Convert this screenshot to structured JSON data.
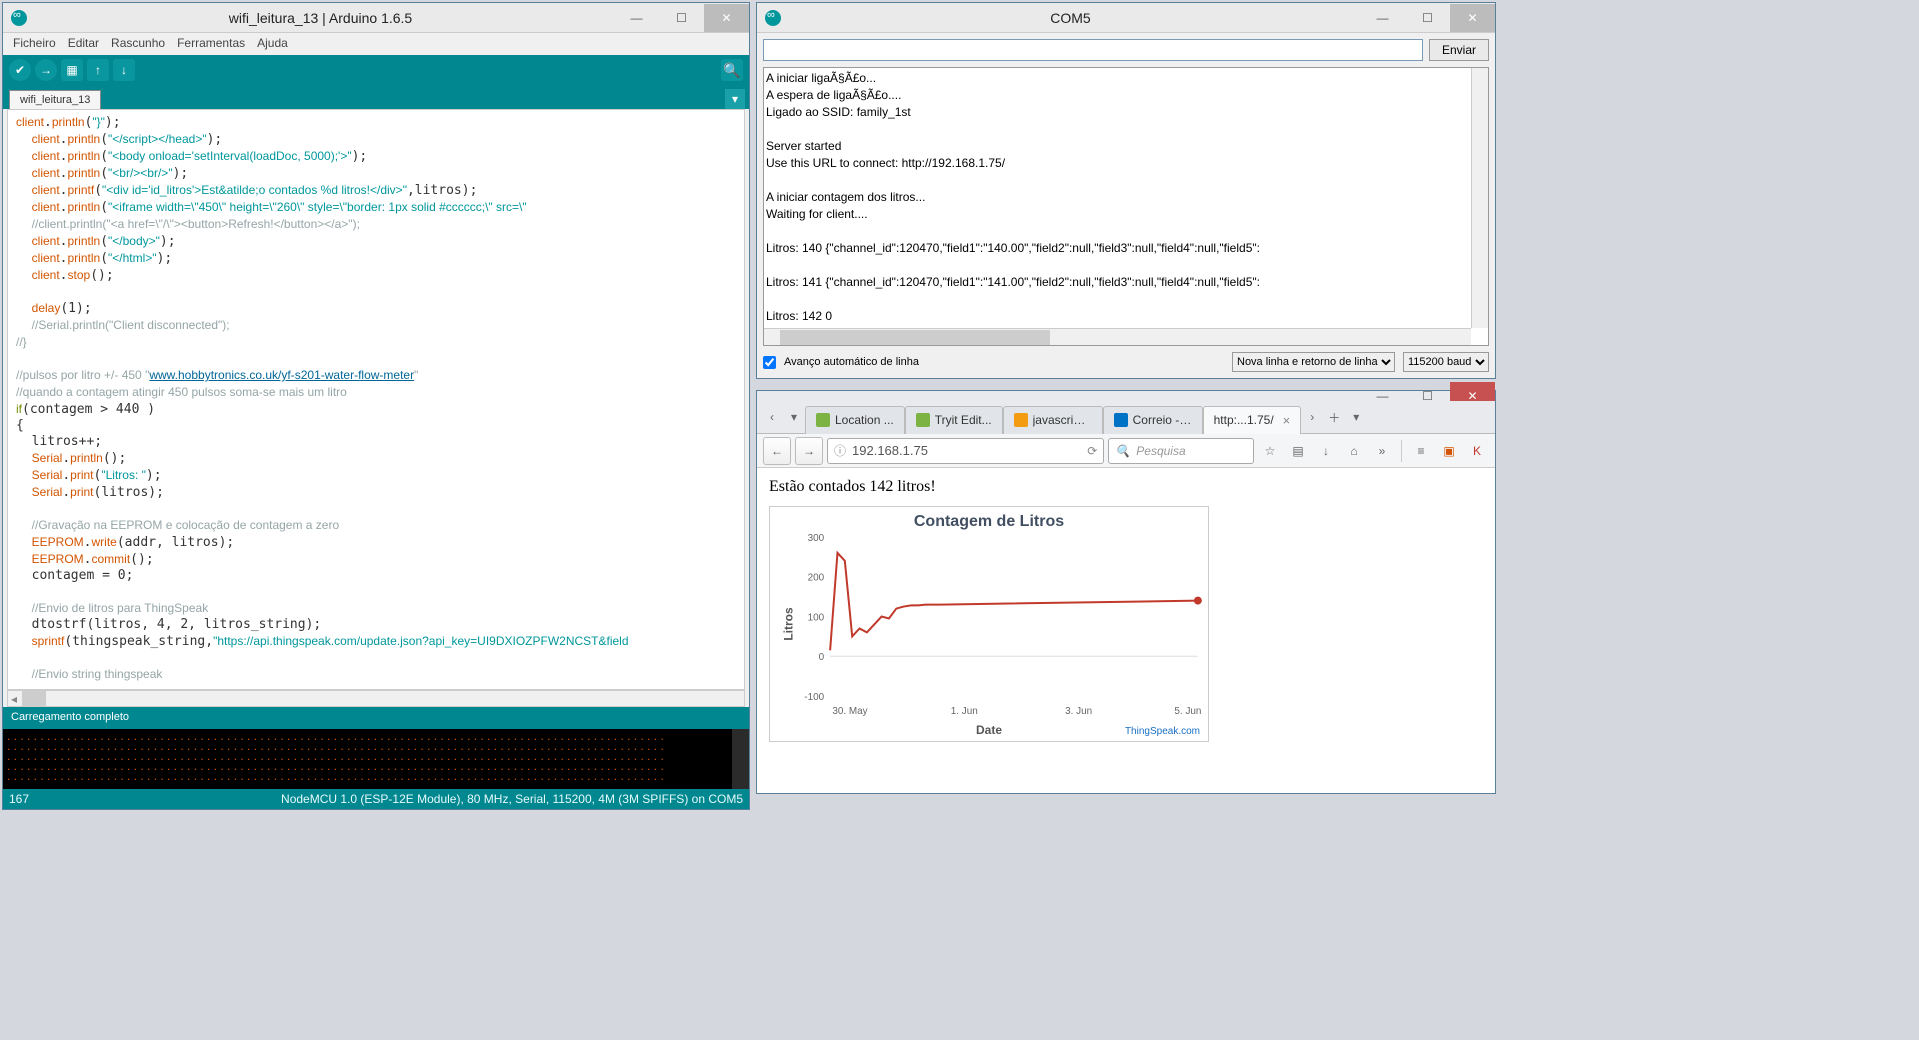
{
  "arduino": {
    "title": "wifi_leitura_13 | Arduino 1.6.5",
    "menus": [
      "Ficheiro",
      "Editar",
      "Rascunho",
      "Ferramentas",
      "Ajuda"
    ],
    "tab_name": "wifi_leitura_13",
    "status": "Carregamento completo",
    "footer_left": "167",
    "footer_right": "NodeMCU 1.0 (ESP-12E Module), 80 MHz, Serial, 115200, 4M (3M SPIFFS) on COM5",
    "console_dots": ". . . . . . . . . . . . . . . . . . . . . . . . . . . . . . . . . . . . . . . . . . . . . . . . . . . . . . . . . . . . . . . . . . . . . . . . . . . . . . . . . . . . . . . . . . . . . . . . . . ."
  },
  "serial": {
    "title": "COM5",
    "send_btn": "Enviar",
    "body_text": "A iniciar ligaÃ§Ã£o...\nA espera de ligaÃ§Ã£o....\nLigado ao SSID: family_1st\n\nServer started\nUse this URL to connect: http://192.168.1.75/\n\nA iniciar contagem dos litros...\nWaiting for client....\n\nLitros: 140 {\"channel_id\":120470,\"field1\":\"140.00\",\"field2\":null,\"field3\":null,\"field4\":null,\"field5\":\n\nLitros: 141 {\"channel_id\":120470,\"field1\":\"141.00\",\"field2\":null,\"field3\":null,\"field4\":null,\"field5\":\n\nLitros: 142 0",
    "autoscroll": "Avanço automático de linha",
    "line_ending": "Nova linha e retorno de linha",
    "baud": "115200 baud"
  },
  "firefox": {
    "tabs": [
      {
        "label": "Location ...",
        "icon_color": "#7cb342"
      },
      {
        "label": "Tryit Edit...",
        "icon_color": "#7cb342"
      },
      {
        "label": "javascript...",
        "icon_color": "#f39c12"
      },
      {
        "label": "Correio - ...",
        "icon_color": "#0072c6"
      },
      {
        "label": "http:...1.75/",
        "icon_color": "#888"
      }
    ],
    "url": "192.168.1.75",
    "search_placeholder": "Pesquisa",
    "page_heading": "Estão contados 142 litros!",
    "ts_link": "ThingSpeak.com"
  },
  "chart_data": {
    "type": "line",
    "title": "Contagem de Litros",
    "xlabel": "Date",
    "ylabel": "Litros",
    "ylim": [
      -100,
      300
    ],
    "yticks": [
      -100,
      0,
      100,
      200,
      300
    ],
    "xticks": [
      "30. May",
      "1. Jun",
      "3. Jun",
      "5. Jun"
    ],
    "x": [
      0,
      0.02,
      0.04,
      0.06,
      0.08,
      0.1,
      0.12,
      0.14,
      0.16,
      0.18,
      0.2,
      0.22,
      0.24,
      0.26,
      0.3,
      1.0
    ],
    "y": [
      15,
      260,
      240,
      50,
      70,
      60,
      80,
      100,
      95,
      120,
      125,
      128,
      128,
      130,
      130,
      140
    ]
  }
}
